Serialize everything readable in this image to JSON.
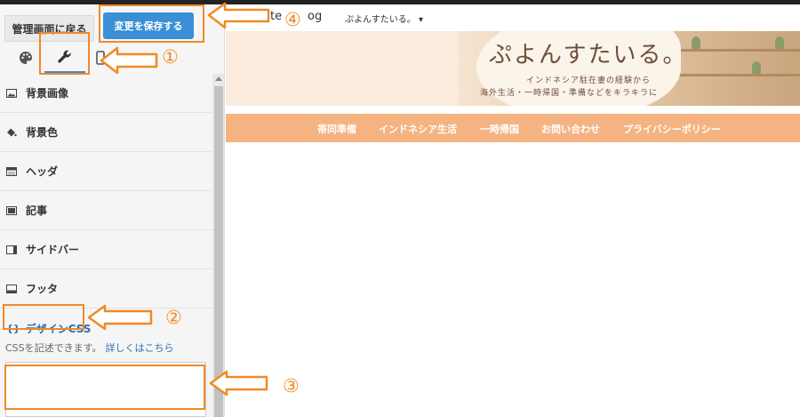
{
  "panel": {
    "back_label": "管理画面に戻る",
    "save_label": "変更を保存する",
    "tabs": [
      "design-tab",
      "tools-tab",
      "device-tab"
    ],
    "items": [
      {
        "label": "背景画像",
        "icon": "image-icon"
      },
      {
        "label": "背景色",
        "icon": "paint-bucket-icon"
      },
      {
        "label": "ヘッダ",
        "icon": "header-layout-icon"
      },
      {
        "label": "記事",
        "icon": "article-icon"
      },
      {
        "label": "サイドバー",
        "icon": "sidebar-layout-icon"
      },
      {
        "label": "フッタ",
        "icon": "footer-layout-icon"
      }
    ],
    "design_css": {
      "brace": "{}",
      "label": "デザインCSS"
    },
    "description": "CSSを記述できます。",
    "description_link": "詳しくはこちら"
  },
  "preview": {
    "logo_text_left": "te",
    "logo_text_right": "og",
    "blog_name": "ぷよんすたいる。 ▾",
    "banner": {
      "title": "ぷよんすたいる。",
      "subtitle_line1": "インドネシア駐在妻の経験から",
      "subtitle_line2": "海外生活・一時帰国・準備などをキラキラに"
    },
    "nav": [
      "帯同準備",
      "インドネシア生活",
      "一時帰国",
      "お問い合わせ",
      "プライバシーポリシー"
    ]
  },
  "annotations": [
    "①",
    "②",
    "③",
    "④"
  ],
  "colors": {
    "accent": "#3b8fd6",
    "annotation": "#f08a24",
    "nav": "#f5b382"
  }
}
